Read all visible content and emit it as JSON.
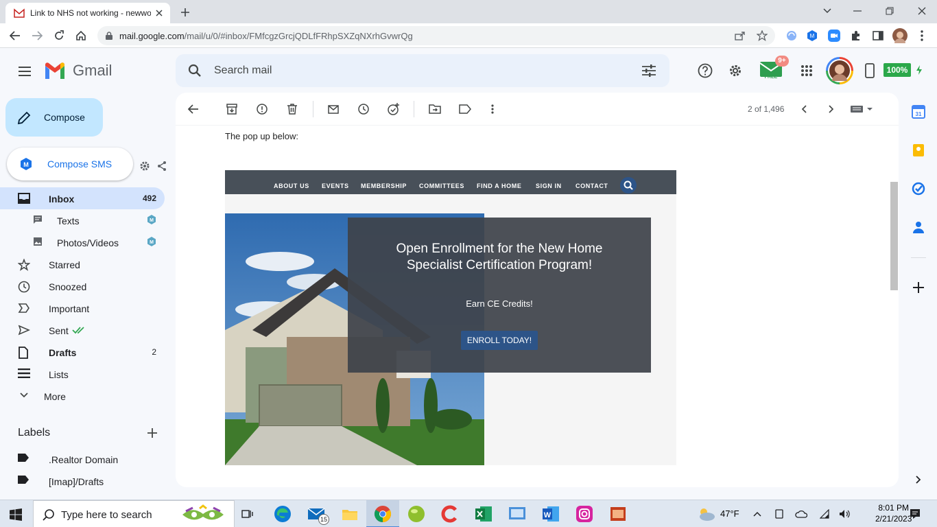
{
  "browser": {
    "tab_title": "Link to NHS not working - newwo",
    "url_host": "mail.google.com",
    "url_path": "/mail/u/0/#inbox/FMfcgzGrcjQDLfFRhpSXZqNXrhGvwrQg"
  },
  "gmail": {
    "logo_text": "Gmail",
    "search_placeholder": "Search mail",
    "battery": "100%",
    "ext_badge": "9+",
    "ext_free": "FREE"
  },
  "sidebar": {
    "compose_label": "Compose",
    "compose_sms_label": "Compose SMS",
    "items": [
      {
        "label": "Inbox",
        "count": "492"
      },
      {
        "label": "Texts",
        "count": ""
      },
      {
        "label": "Photos/Videos",
        "count": ""
      },
      {
        "label": "Starred",
        "count": ""
      },
      {
        "label": "Snoozed",
        "count": ""
      },
      {
        "label": "Important",
        "count": ""
      },
      {
        "label": "Sent",
        "count": ""
      },
      {
        "label": "Drafts",
        "count": "2"
      },
      {
        "label": "Lists",
        "count": ""
      },
      {
        "label": "More",
        "count": ""
      }
    ],
    "labels_heading": "Labels",
    "labels": [
      ".Realtor Domain",
      "[Imap]/Drafts"
    ]
  },
  "message": {
    "pager": "2 of 1,496",
    "intro_text": "The pop up below:",
    "site_nav": [
      "ABOUT US",
      "EVENTS",
      "MEMBERSHIP",
      "COMMITTEES",
      "FIND A HOME",
      "SIGN IN",
      "CONTACT"
    ],
    "popup_title": "Open Enrollment for the New Home Specialist Certification Program!",
    "popup_subtitle": "Earn CE Credits!",
    "popup_button": "ENROLL TODAY!"
  },
  "taskbar": {
    "search_placeholder": "Type here to search",
    "mail_badge": "15",
    "weather": "47°F",
    "time": "8:01 PM",
    "date": "2/21/2023"
  },
  "colors": {
    "compose_bg": "#c2e7ff",
    "inbox_active": "#d3e3fd",
    "site_nav_bg": "#485059",
    "enroll_button": "#2d5488"
  }
}
